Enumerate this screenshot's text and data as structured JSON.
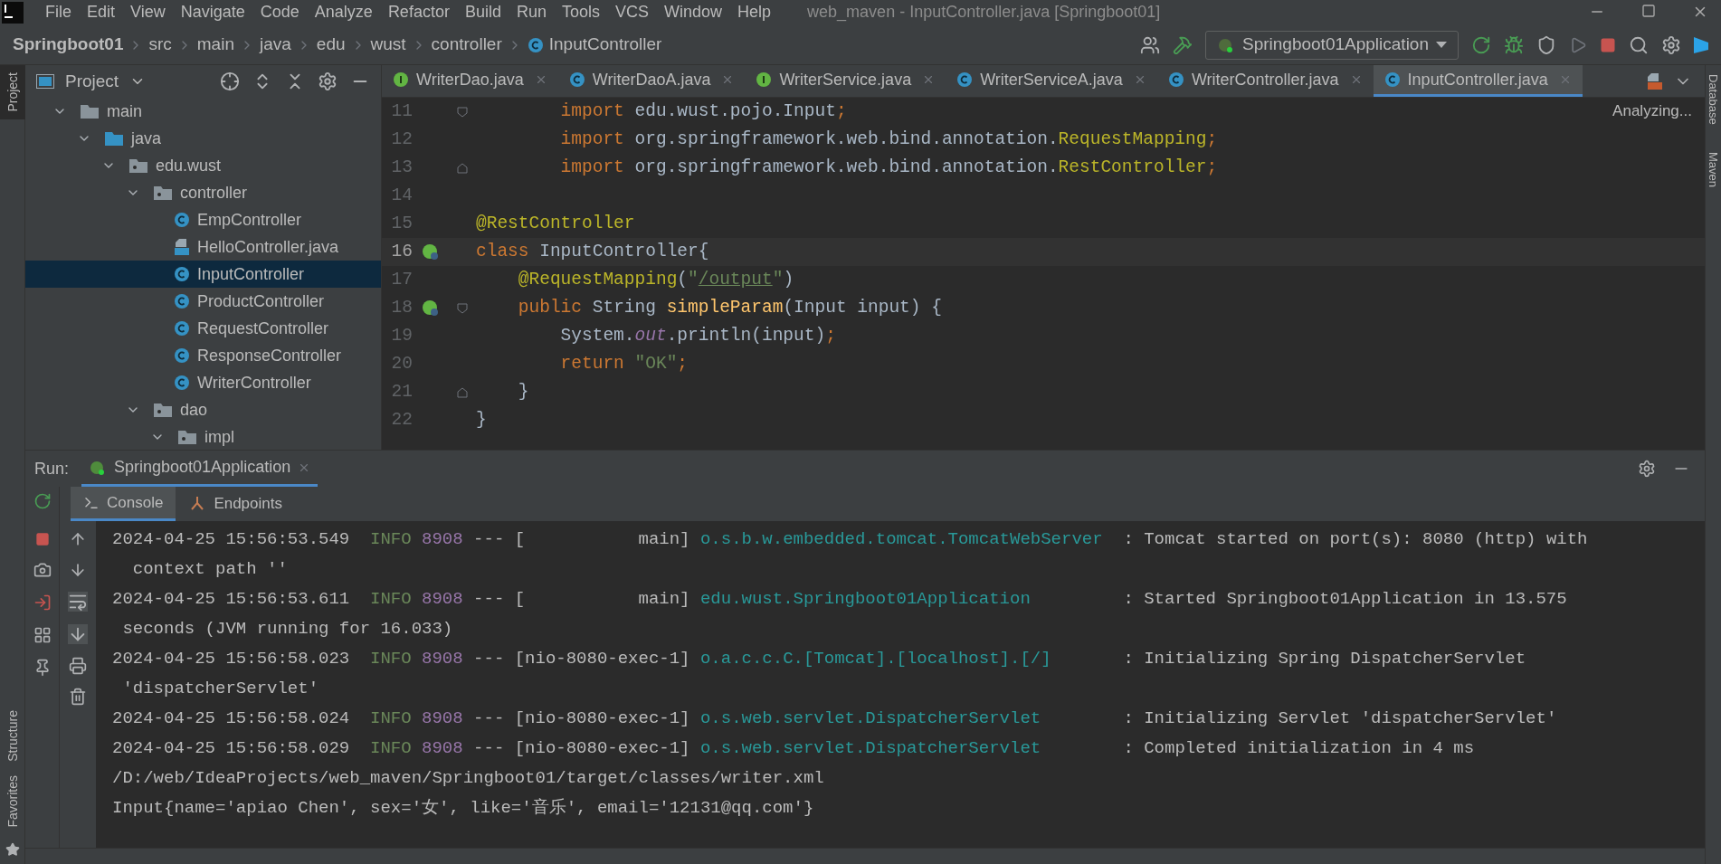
{
  "window": {
    "title": "web_maven - InputController.java [Springboot01]"
  },
  "menu": [
    "File",
    "Edit",
    "View",
    "Navigate",
    "Code",
    "Analyze",
    "Refactor",
    "Build",
    "Run",
    "Tools",
    "VCS",
    "Window",
    "Help"
  ],
  "breadcrumbs": [
    {
      "label": "Springboot01",
      "kind": "project"
    },
    {
      "label": "src",
      "kind": "folder"
    },
    {
      "label": "main",
      "kind": "folder"
    },
    {
      "label": "java",
      "kind": "folder"
    },
    {
      "label": "edu",
      "kind": "folder"
    },
    {
      "label": "wust",
      "kind": "folder"
    },
    {
      "label": "controller",
      "kind": "folder"
    },
    {
      "label": "InputController",
      "kind": "class"
    }
  ],
  "run_config": {
    "label": "Springboot01Application"
  },
  "left_strip": [
    {
      "label": "Project",
      "selected": true
    },
    {
      "label": "Structure",
      "selected": false
    },
    {
      "label": "Favorites",
      "selected": false
    }
  ],
  "right_strip": [
    {
      "label": "Database"
    },
    {
      "label": "Maven"
    }
  ],
  "project_panel": {
    "title": "Project",
    "tree": [
      {
        "label": "main",
        "kind": "folder",
        "expanded": true,
        "selected": false,
        "children": [
          {
            "label": "java",
            "kind": "source",
            "expanded": true,
            "selected": false,
            "children": [
              {
                "label": "edu.wust",
                "kind": "package",
                "expanded": true,
                "selected": false,
                "children": [
                  {
                    "label": "controller",
                    "kind": "package",
                    "expanded": true,
                    "selected": false,
                    "children": [
                      {
                        "label": "EmpController",
                        "kind": "class",
                        "selected": false
                      },
                      {
                        "label": "HelloController.java",
                        "kind": "file",
                        "selected": false
                      },
                      {
                        "label": "InputController",
                        "kind": "class",
                        "selected": true
                      },
                      {
                        "label": "ProductController",
                        "kind": "class",
                        "selected": false
                      },
                      {
                        "label": "RequestController",
                        "kind": "class",
                        "selected": false
                      },
                      {
                        "label": "ResponseController",
                        "kind": "class",
                        "selected": false
                      },
                      {
                        "label": "WriterController",
                        "kind": "class",
                        "selected": false
                      }
                    ]
                  },
                  {
                    "label": "dao",
                    "kind": "package",
                    "expanded": true,
                    "selected": false,
                    "children": [
                      {
                        "label": "impl",
                        "kind": "package",
                        "expanded": true,
                        "selected": false
                      }
                    ]
                  }
                ]
              }
            ]
          }
        ]
      }
    ]
  },
  "editor_tabs": [
    {
      "label": "WriterDao.java",
      "kind": "interface",
      "selected": false
    },
    {
      "label": "WriterDaoA.java",
      "kind": "class",
      "selected": false
    },
    {
      "label": "WriterService.java",
      "kind": "interface",
      "selected": false
    },
    {
      "label": "WriterServiceA.java",
      "kind": "class",
      "selected": false
    },
    {
      "label": "WriterController.java",
      "kind": "class",
      "selected": false
    },
    {
      "label": "InputController.java",
      "kind": "class",
      "selected": true
    }
  ],
  "editor": {
    "status": "Analyzing...",
    "lines": [
      {
        "number": "11",
        "fold_start": true,
        "fold_end": false,
        "bean": false,
        "current": false,
        "segments": [
          {
            "t": "        import ",
            "kind": "keyword"
          },
          {
            "t": "edu.wust.pojo.Input",
            "kind": "plain"
          },
          {
            "t": ";",
            "kind": "keyword"
          }
        ]
      },
      {
        "number": "12",
        "fold_start": false,
        "fold_end": false,
        "bean": false,
        "current": false,
        "segments": [
          {
            "t": "        import ",
            "kind": "keyword"
          },
          {
            "t": "org.springframework.web.bind.annotation.",
            "kind": "plain"
          },
          {
            "t": "RequestMapping",
            "kind": "annotation"
          },
          {
            "t": ";",
            "kind": "keyword"
          }
        ]
      },
      {
        "number": "13",
        "fold_start": false,
        "fold_end": true,
        "bean": false,
        "current": false,
        "segments": [
          {
            "t": "        import ",
            "kind": "keyword"
          },
          {
            "t": "org.springframework.web.bind.annotation.",
            "kind": "plain"
          },
          {
            "t": "RestController",
            "kind": "annotation"
          },
          {
            "t": ";",
            "kind": "keyword"
          }
        ]
      },
      {
        "number": "14",
        "fold_start": false,
        "fold_end": false,
        "bean": false,
        "current": false
      },
      {
        "number": "15",
        "fold_start": false,
        "fold_end": false,
        "bean": false,
        "current": false,
        "segments": [
          {
            "t": "@RestController",
            "kind": "annotation"
          }
        ]
      },
      {
        "number": "16",
        "fold_start": false,
        "fold_end": false,
        "bean": true,
        "current": true,
        "segments": [
          {
            "t": "class ",
            "kind": "keyword"
          },
          {
            "t": "InputController{",
            "kind": "plain"
          }
        ]
      },
      {
        "number": "17",
        "fold_start": false,
        "fold_end": false,
        "bean": false,
        "current": false,
        "segments": [
          {
            "t": "    @RequestMapping",
            "kind": "annotation"
          },
          {
            "t": "(",
            "kind": "plain"
          },
          {
            "t": "\"",
            "kind": "string"
          },
          {
            "t": "/output",
            "kind": "link"
          },
          {
            "t": "\"",
            "kind": "string"
          },
          {
            "t": ")",
            "kind": "plain"
          }
        ]
      },
      {
        "number": "18",
        "fold_start": true,
        "fold_end": false,
        "bean": true,
        "current": false,
        "segments": [
          {
            "t": "    public ",
            "kind": "keyword"
          },
          {
            "t": "String ",
            "kind": "plain"
          },
          {
            "t": "simpleParam",
            "kind": "method"
          },
          {
            "t": "(Input input) {",
            "kind": "plain"
          }
        ]
      },
      {
        "number": "19",
        "fold_start": false,
        "fold_end": false,
        "bean": false,
        "current": false,
        "segments": [
          {
            "t": "        System.",
            "kind": "plain"
          },
          {
            "t": "out",
            "kind": "field"
          },
          {
            "t": ".println(input)",
            "kind": "plain"
          },
          {
            "t": ";",
            "kind": "keyword"
          }
        ]
      },
      {
        "number": "20",
        "fold_start": false,
        "fold_end": false,
        "bean": false,
        "current": false,
        "segments": [
          {
            "t": "        return ",
            "kind": "keyword"
          },
          {
            "t": "\"OK\"",
            "kind": "string"
          },
          {
            "t": ";",
            "kind": "keyword"
          }
        ]
      },
      {
        "number": "21",
        "fold_start": false,
        "fold_end": true,
        "bean": false,
        "current": false,
        "segments": [
          {
            "t": "    }",
            "kind": "plain"
          }
        ]
      },
      {
        "number": "22",
        "fold_start": false,
        "fold_end": false,
        "bean": false,
        "current": false,
        "segments": [
          {
            "t": "}",
            "kind": "plain"
          }
        ]
      }
    ]
  },
  "run_panel": {
    "label": "Run:",
    "tab": "Springboot01Application",
    "tabs": [
      {
        "label": "Console",
        "kind": "console",
        "selected": true
      },
      {
        "label": "Endpoints",
        "kind": "endpoints",
        "selected": false
      }
    ],
    "console": [
      [
        {
          "t": "2024-04-25 15:56:53.549  ",
          "kind": "plain"
        },
        {
          "t": "INFO",
          "kind": "info"
        },
        {
          "t": " 8908",
          "kind": "pid"
        },
        {
          "t": " --- [           main] ",
          "kind": "plain"
        },
        {
          "t": "o.s.b.w.embedded.tomcat.TomcatWebServer",
          "kind": "logger"
        },
        {
          "t": "  : Tomcat started on port(s): 8080 (http) with",
          "kind": "plain"
        }
      ],
      [
        {
          "t": "  context path ''",
          "kind": "plain"
        }
      ],
      [
        {
          "t": "2024-04-25 15:56:53.611  ",
          "kind": "plain"
        },
        {
          "t": "INFO",
          "kind": "info"
        },
        {
          "t": " 8908",
          "kind": "pid"
        },
        {
          "t": " --- [           main] ",
          "kind": "plain"
        },
        {
          "t": "edu.wust.Springboot01Application",
          "kind": "logger"
        },
        {
          "t": "         : Started Springboot01Application in 13.575",
          "kind": "plain"
        }
      ],
      [
        {
          "t": " seconds (JVM running for 16.033)",
          "kind": "plain"
        }
      ],
      [
        {
          "t": "2024-04-25 15:56:58.023  ",
          "kind": "plain"
        },
        {
          "t": "INFO",
          "kind": "info"
        },
        {
          "t": " 8908",
          "kind": "pid"
        },
        {
          "t": " --- [nio-8080-exec-1] ",
          "kind": "plain"
        },
        {
          "t": "o.a.c.c.C.[Tomcat].[localhost].[/]",
          "kind": "logger"
        },
        {
          "t": "       : Initializing Spring DispatcherServlet",
          "kind": "plain"
        }
      ],
      [
        {
          "t": " 'dispatcherServlet'",
          "kind": "plain"
        }
      ],
      [
        {
          "t": "2024-04-25 15:56:58.024  ",
          "kind": "plain"
        },
        {
          "t": "INFO",
          "kind": "info"
        },
        {
          "t": " 8908",
          "kind": "pid"
        },
        {
          "t": " --- [nio-8080-exec-1] ",
          "kind": "plain"
        },
        {
          "t": "o.s.web.servlet.DispatcherServlet",
          "kind": "logger"
        },
        {
          "t": "        : Initializing Servlet 'dispatcherServlet'",
          "kind": "plain"
        }
      ],
      [
        {
          "t": "2024-04-25 15:56:58.029  ",
          "kind": "plain"
        },
        {
          "t": "INFO",
          "kind": "info"
        },
        {
          "t": " 8908",
          "kind": "pid"
        },
        {
          "t": " --- [nio-8080-exec-1] ",
          "kind": "plain"
        },
        {
          "t": "o.s.web.servlet.DispatcherServlet",
          "kind": "logger"
        },
        {
          "t": "        : Completed initialization in 4 ms",
          "kind": "plain"
        }
      ],
      [
        {
          "t": "/D:/web/IdeaProjects/web_maven/Springboot01/target/classes/writer.xml",
          "kind": "plain"
        }
      ],
      [
        {
          "t": "Input{name='apiao Chen', sex='女', like='音乐', email='12131@qq.com'}",
          "kind": "plain"
        }
      ]
    ]
  }
}
